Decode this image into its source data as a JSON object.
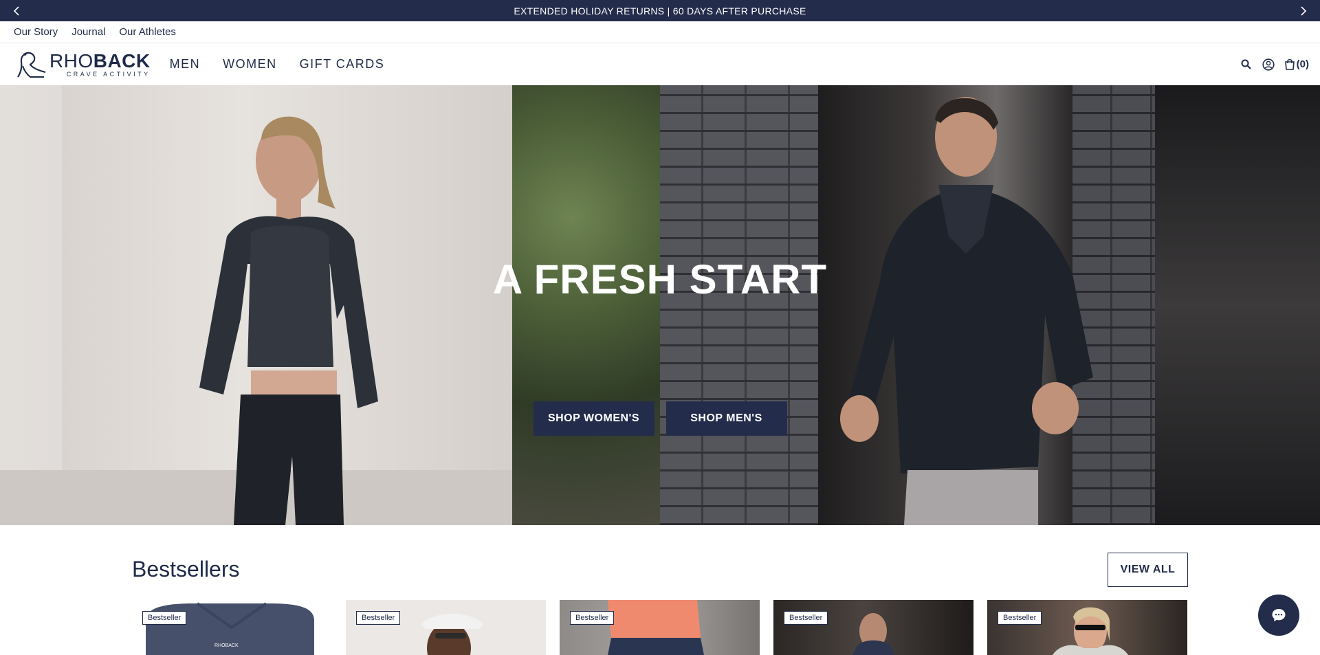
{
  "announcement": {
    "text": "EXTENDED HOLIDAY RETURNS | 60 DAYS AFTER PURCHASE",
    "prev_icon": "chevron-left-icon",
    "next_icon": "chevron-right-icon"
  },
  "utility_nav": {
    "items": [
      {
        "label": "Our Story"
      },
      {
        "label": "Journal"
      },
      {
        "label": "Our Athletes"
      }
    ]
  },
  "header": {
    "logo": {
      "main_bold": "BACK",
      "main_thin": "RHO",
      "sub": "CRAVE ACTIVITY"
    },
    "nav": [
      {
        "label": "MEN"
      },
      {
        "label": "WOMEN"
      },
      {
        "label": "GIFT CARDS"
      }
    ],
    "icons": [
      "search-icon",
      "account-icon",
      "cart-icon"
    ],
    "cart_count": "(0)"
  },
  "hero": {
    "title": "A FRESH START",
    "buttons": [
      {
        "label": "SHOP WOMEN'S"
      },
      {
        "label": "SHOP MEN'S"
      }
    ]
  },
  "bestsellers": {
    "title": "Bestsellers",
    "view_all": "VIEW ALL",
    "cards": [
      {
        "badge": "Bestseller"
      },
      {
        "badge": "Bestseller"
      },
      {
        "badge": "Bestseller"
      },
      {
        "badge": "Bestseller"
      },
      {
        "badge": "Bestseller"
      }
    ]
  },
  "colors": {
    "brand_navy": "#232c4b",
    "text": "#1f2a48",
    "white": "#ffffff"
  },
  "chat": {
    "icon": "chat-bubble-icon"
  }
}
